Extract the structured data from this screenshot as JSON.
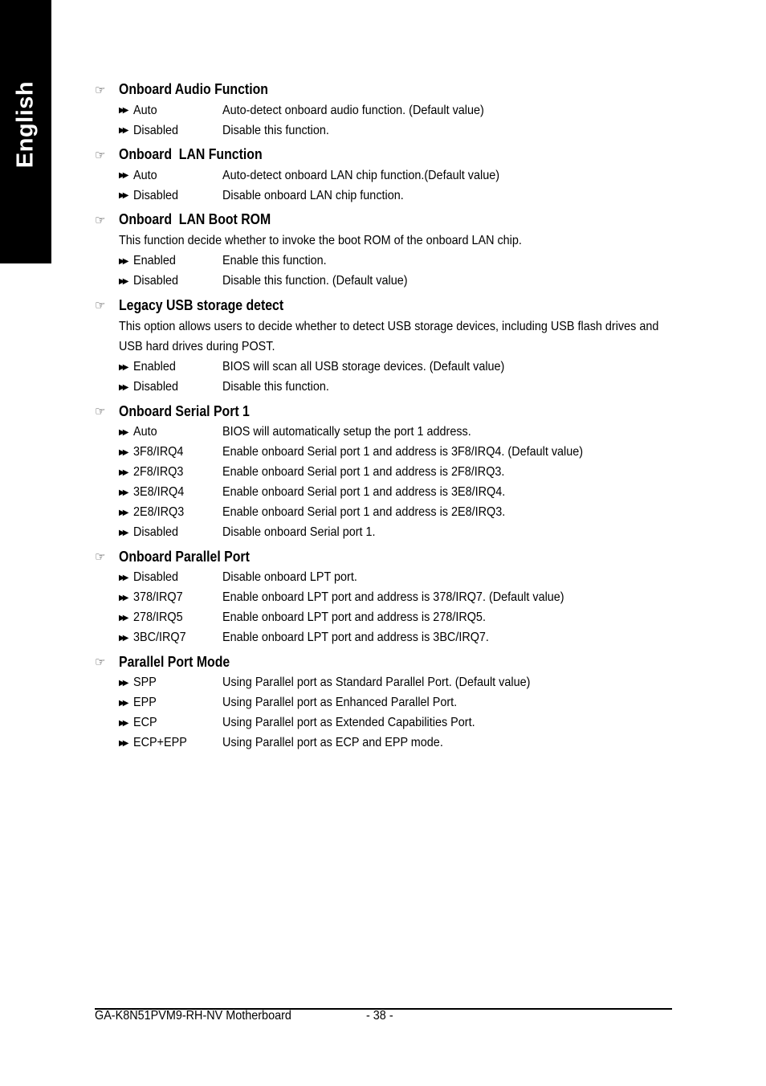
{
  "side_tab": {
    "label": "English"
  },
  "sections": [
    {
      "title": "Onboard Audio Function",
      "description": null,
      "options": [
        {
          "name": "Auto",
          "text": "Auto-detect onboard audio function. (Default value)"
        },
        {
          "name": "Disabled",
          "text": "Disable this function."
        }
      ]
    },
    {
      "title": "Onboard  LAN Function",
      "description": null,
      "options": [
        {
          "name": "Auto",
          "text": "Auto-detect onboard LAN chip function.(Default value)"
        },
        {
          "name": "Disabled",
          "text": "Disable onboard LAN chip function."
        }
      ]
    },
    {
      "title": "Onboard  LAN Boot ROM",
      "description": "This function decide whether to invoke the boot ROM of the onboard LAN chip.",
      "options": [
        {
          "name": "Enabled",
          "text": "Enable this function."
        },
        {
          "name": "Disabled",
          "text": "Disable this function. (Default value)"
        }
      ]
    },
    {
      "title": "Legacy USB storage detect",
      "description": "This option allows users to decide whether to detect USB storage devices, including USB flash drives and USB hard drives during POST.",
      "options": [
        {
          "name": "Enabled",
          "text": "BIOS will scan all USB storage devices. (Default value)"
        },
        {
          "name": "Disabled",
          "text": "Disable this function."
        }
      ]
    },
    {
      "title": "Onboard Serial Port 1",
      "description": null,
      "options": [
        {
          "name": "Auto",
          "text": "BIOS will automatically setup the port 1 address."
        },
        {
          "name": "3F8/IRQ4",
          "text": "Enable onboard Serial port 1 and address is 3F8/IRQ4. (Default value)"
        },
        {
          "name": "2F8/IRQ3",
          "text": "Enable onboard Serial port 1 and address is 2F8/IRQ3."
        },
        {
          "name": "3E8/IRQ4",
          "text": "Enable onboard Serial port 1 and address is 3E8/IRQ4."
        },
        {
          "name": "2E8/IRQ3",
          "text": "Enable onboard Serial port 1 and address is 2E8/IRQ3."
        },
        {
          "name": "Disabled",
          "text": "Disable onboard Serial port 1."
        }
      ]
    },
    {
      "title": "Onboard Parallel Port",
      "description": null,
      "options": [
        {
          "name": "Disabled",
          "text": "Disable onboard LPT port."
        },
        {
          "name": "378/IRQ7",
          "text": "Enable onboard LPT port and address is 378/IRQ7. (Default value)"
        },
        {
          "name": "278/IRQ5",
          "text": "Enable onboard LPT port and address is 278/IRQ5."
        },
        {
          "name": "3BC/IRQ7",
          "text": "Enable onboard LPT port and address is 3BC/IRQ7."
        }
      ]
    },
    {
      "title": "Parallel Port Mode",
      "description": null,
      "options": [
        {
          "name": "SPP",
          "text": "Using Parallel port as Standard Parallel Port. (Default value)"
        },
        {
          "name": "EPP",
          "text": "Using Parallel port as Enhanced Parallel Port."
        },
        {
          "name": "ECP",
          "text": "Using Parallel port as Extended Capabilities Port."
        },
        {
          "name": "ECP+EPP",
          "text": "Using Parallel port as ECP and EPP mode."
        }
      ]
    }
  ],
  "icons": {
    "heading": "pointing-hand-icon",
    "option": "double-arrow-icon"
  },
  "footer": {
    "model": "GA-K8N51PVM9-RH-NV Motherboard",
    "page": "- 38 -"
  }
}
